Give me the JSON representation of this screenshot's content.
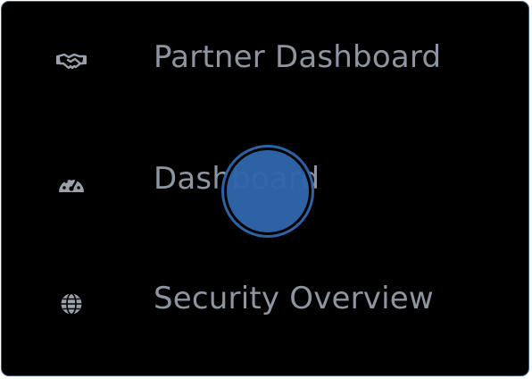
{
  "menu": {
    "items": [
      {
        "label": "Partner Dashboard",
        "icon": "handshake-icon"
      },
      {
        "label": "Dashboard",
        "icon": "speedometer-icon"
      },
      {
        "label": "Security Overview",
        "icon": "globe-icon"
      }
    ]
  },
  "colors": {
    "background": "#000000",
    "border": "#3d5a80",
    "text": "#8d95a0",
    "icon": "#9aa1ab",
    "cursor": "#2f67ac"
  }
}
